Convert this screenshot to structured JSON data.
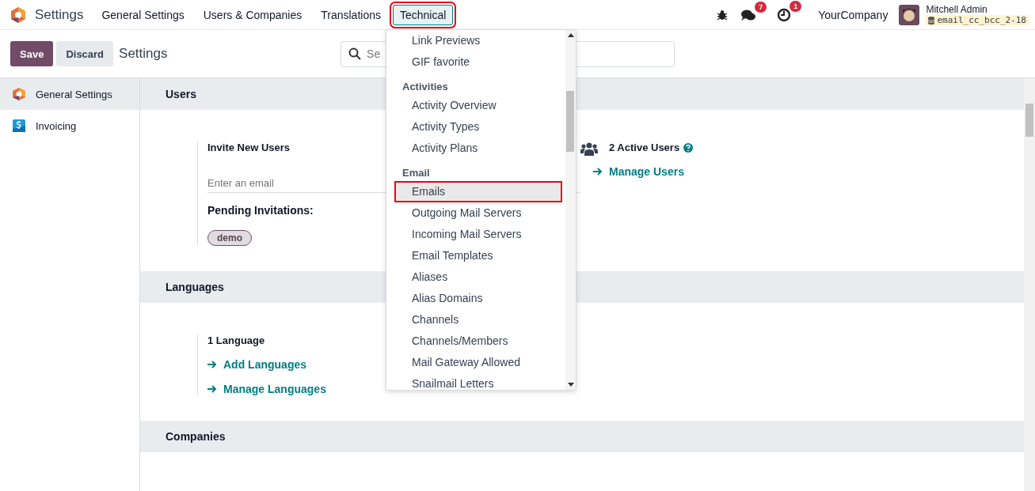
{
  "app": {
    "name": "Settings"
  },
  "menu": [
    {
      "label": "General Settings",
      "selected": false,
      "annotated": false
    },
    {
      "label": "Users & Companies",
      "selected": false,
      "annotated": false
    },
    {
      "label": "Translations",
      "selected": false,
      "annotated": false
    },
    {
      "label": "Technical",
      "selected": true,
      "annotated": true
    }
  ],
  "systray": {
    "messages_badge": "7",
    "activities_badge": "1",
    "company": "YourCompany",
    "user": {
      "name": "Mitchell Admin",
      "database": "email_cc_bcc_2-18"
    }
  },
  "control_panel": {
    "buttons": [
      {
        "label": "Save",
        "kind": "primary"
      },
      {
        "label": "Discard",
        "kind": "secondary"
      }
    ],
    "breadcrumb": "Settings",
    "search": {
      "placeholder": "Se"
    }
  },
  "sidebar": {
    "items": [
      {
        "label": "General Settings",
        "selected": true,
        "kind": "settings"
      },
      {
        "label": "Invoicing",
        "selected": false,
        "kind": "invoicing"
      }
    ]
  },
  "sections": [
    {
      "title": "Users",
      "settings": [
        {
          "kind": "invite",
          "title": "Invite New Users",
          "input_placeholder": "Enter an email",
          "subtitle": "Pending Invitations:",
          "tags": [
            "demo"
          ]
        },
        {
          "kind": "users",
          "title": "2 Active Users",
          "help": true,
          "links": [
            "Manage Users"
          ]
        }
      ]
    },
    {
      "title": "Languages",
      "settings": [
        {
          "kind": "languages",
          "title": "1 Language",
          "links": [
            "Add Languages",
            "Manage Languages"
          ]
        }
      ]
    },
    {
      "title": "Companies"
    }
  ],
  "dropdown": {
    "groups": [
      {
        "items": [
          {
            "label": "Link Previews",
            "selected": false,
            "annotated": false
          },
          {
            "label": "GIF favorite",
            "selected": false,
            "annotated": false
          }
        ]
      },
      {
        "heading": "Activities",
        "items": [
          {
            "label": "Activity Overview",
            "selected": false,
            "annotated": false
          },
          {
            "label": "Activity Types",
            "selected": false,
            "annotated": false
          },
          {
            "label": "Activity Plans",
            "selected": false,
            "annotated": false
          }
        ]
      },
      {
        "heading": "Email",
        "items": [
          {
            "label": "Emails",
            "selected": true,
            "annotated": true
          },
          {
            "label": "Outgoing Mail Servers",
            "selected": false,
            "annotated": false
          },
          {
            "label": "Incoming Mail Servers",
            "selected": false,
            "annotated": false
          },
          {
            "label": "Email Templates",
            "selected": false,
            "annotated": false
          },
          {
            "label": "Aliases",
            "selected": false,
            "annotated": false
          },
          {
            "label": "Alias Domains",
            "selected": false,
            "annotated": false
          },
          {
            "label": "Channels",
            "selected": false,
            "annotated": false
          },
          {
            "label": "Channels/Members",
            "selected": false,
            "annotated": false
          },
          {
            "label": "Mail Gateway Allowed",
            "selected": false,
            "annotated": false
          },
          {
            "label": "Snailmail Letters",
            "selected": false,
            "annotated": false
          }
        ]
      }
    ]
  }
}
